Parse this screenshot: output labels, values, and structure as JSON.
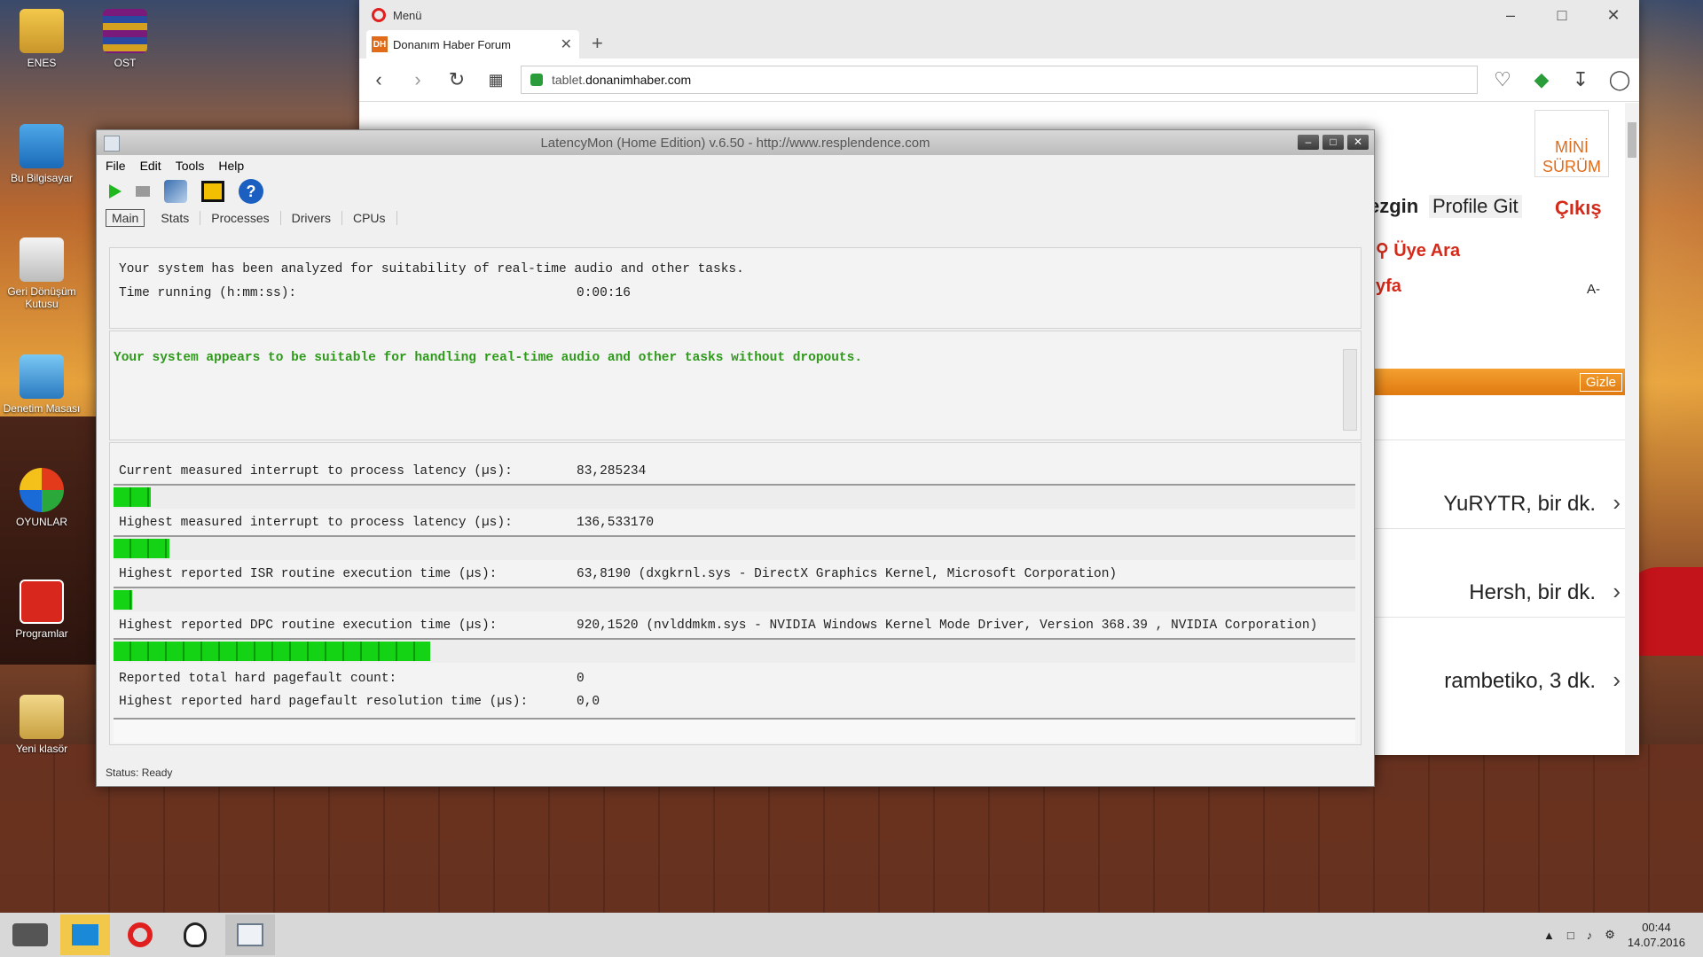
{
  "desktop": {
    "icons": [
      {
        "label": "ENES"
      },
      {
        "label": "OST"
      },
      {
        "label": "Bu Bilgisayar"
      },
      {
        "label": "Geri Dönüşüm Kutusu"
      },
      {
        "label": "Denetim Masası"
      },
      {
        "label": "OYUNLAR"
      },
      {
        "label": "Programlar"
      },
      {
        "label": "Yeni klasör"
      }
    ]
  },
  "opera": {
    "menu_label": "Menü",
    "tab_title": "Donanım Haber Forum",
    "tab_favicon": "DH",
    "url_host": "tablet.",
    "url_domain": "donanimhaber.com",
    "mini_surum": "MİNİ SÜRÜM",
    "nav_gezgin": "ezgin",
    "profile_link": "Profile Git",
    "logout_link": "Çıkış",
    "member_search": "Üye Ara",
    "page_link": "yfa",
    "font_small": "A-",
    "hide_button": "Gizle",
    "posts": [
      {
        "text": "YuRYTR, bir dk."
      },
      {
        "text": "Hersh, bir dk."
      },
      {
        "text": "rambetiko, 3 dk."
      }
    ]
  },
  "latencymon": {
    "title": "LatencyMon  (Home Edition)  v.6.50 - http://www.resplendence.com",
    "menu": {
      "file": "File",
      "edit": "Edit",
      "tools": "Tools",
      "help": "Help"
    },
    "tabs": {
      "main": "Main",
      "stats": "Stats",
      "processes": "Processes",
      "drivers": "Drivers",
      "cpus": "CPUs"
    },
    "summary_line": "Your system has been analyzed for suitability of real-time audio and other tasks.",
    "time_running_label": "Time running (h:mm:ss):",
    "time_running_value": "0:00:16",
    "verdict": "Your system appears to be suitable for handling real-time audio and other tasks without dropouts.",
    "metrics": [
      {
        "label": "Current measured interrupt to process latency (µs):",
        "value": "83,285234",
        "bar_fraction": 0.03
      },
      {
        "label": "Highest measured interrupt to process latency (µs):",
        "value": "136,533170",
        "bar_fraction": 0.045
      },
      {
        "label": "Highest reported ISR routine execution time (µs):",
        "value": "63,8190   (dxgkrnl.sys - DirectX Graphics Kernel, Microsoft Corporation)",
        "bar_fraction": 0.015
      },
      {
        "label": "Highest reported DPC routine execution time (µs):",
        "value": "920,1520   (nvlddmkm.sys - NVIDIA Windows Kernel Mode Driver, Version 368.39 , NVIDIA Corporation)",
        "bar_fraction": 0.255
      }
    ],
    "pagefault_count_label": "Reported total hard pagefault count:",
    "pagefault_count_value": "0",
    "pagefault_time_label": "Highest reported hard pagefault resolution time (µs):",
    "pagefault_time_value": "0,0",
    "status": "Status: Ready"
  },
  "taskbar": {
    "time": "00:44",
    "date": "14.07.2016"
  }
}
